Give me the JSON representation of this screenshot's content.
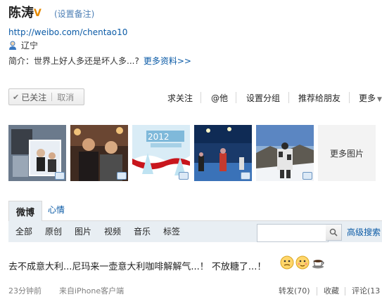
{
  "profile": {
    "name": "陈涛",
    "verified_badge": "V",
    "remark_link": "(设置备注)",
    "url": "http://weibo.com/chentao10",
    "location": "辽宁",
    "intro": "简介：世界上好人多还是坏人多...?",
    "more_info": "更多资料>>"
  },
  "follow": {
    "status": "已关注",
    "cancel": "取消"
  },
  "actions": [
    "求关注",
    "@他",
    "设置分组",
    "推荐给朋友",
    "更多"
  ],
  "photos": {
    "more_label": "更多图片",
    "overlay_text": "2012"
  },
  "tabs": [
    "微博",
    "心情"
  ],
  "filters": [
    "全部",
    "原创",
    "图片",
    "视频",
    "音乐",
    "标签"
  ],
  "search": {
    "placeholder": "",
    "advanced": "高级搜索"
  },
  "post": {
    "text": "去不成意大利...尼玛来一壶意大利咖啡解解气...！ 不放糖了...！",
    "time": "23分钟前",
    "source": "来自iPhone客户端",
    "repost": "转发(70)",
    "favorite": "收藏",
    "comment": "评论(13"
  },
  "colors": {
    "link": "#0a5aa6",
    "bar_bg": "#e8eef3",
    "badge": "#e68a00"
  }
}
